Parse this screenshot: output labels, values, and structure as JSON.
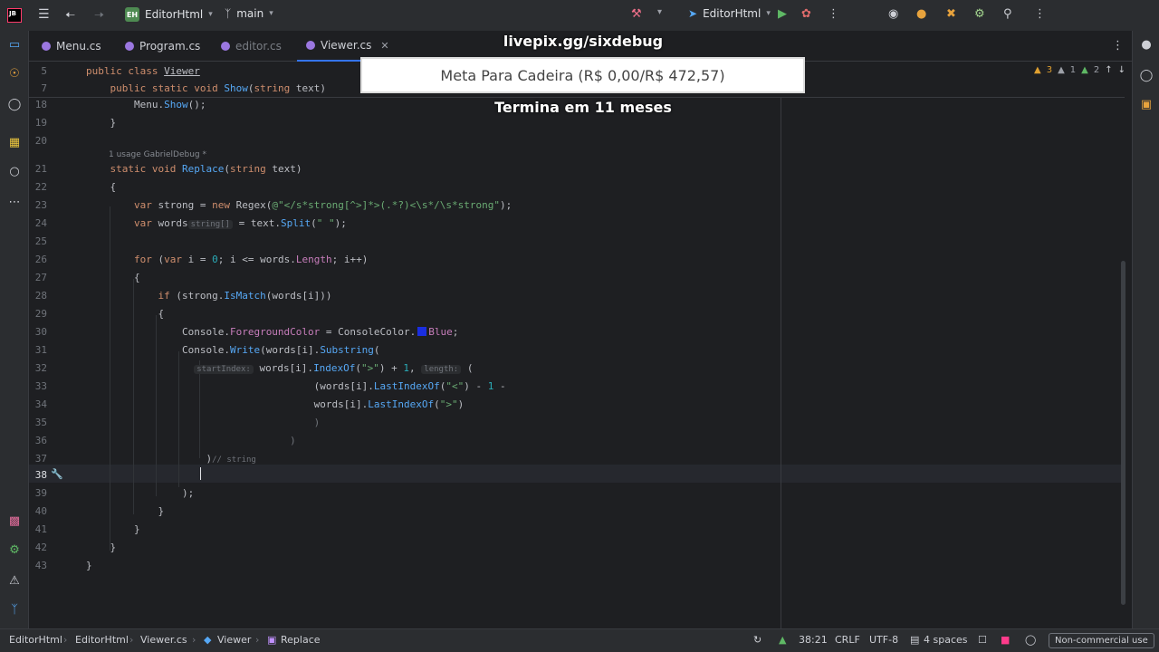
{
  "titlebar": {
    "logo_text": "JB",
    "project_badge": "EH",
    "project_name": "EditorHtml",
    "branch": "main",
    "run_config": "EditorHtml"
  },
  "tabs": [
    {
      "label": "Menu.cs",
      "active": false
    },
    {
      "label": "Program.cs",
      "active": false
    },
    {
      "label": "editor.cs",
      "active": false
    },
    {
      "label": "Viewer.cs",
      "active": true
    }
  ],
  "overlay": {
    "host": "livepix.gg/sixdebug",
    "goal": "Meta Para Cadeira (R$ 0,00/R$ 472,57)",
    "ends": "Termina em 11 meses"
  },
  "problems": {
    "warnings": "3",
    "weak": "1",
    "typos": "2"
  },
  "code": {
    "sticky": [
      {
        "num": "5",
        "text": "public class Viewer"
      },
      {
        "num": "7",
        "text": "    public static void Show(string text)"
      }
    ],
    "usage_hint": "1 usage   GabrielDebug *",
    "lines": [
      {
        "num": "18",
        "text": "        Menu.Show();"
      },
      {
        "num": "19",
        "text": "    }"
      },
      {
        "num": "20",
        "text": ""
      },
      {
        "num": "21",
        "text": "    static void Replace(string text)"
      },
      {
        "num": "22",
        "text": "    {"
      },
      {
        "num": "23",
        "text": "        var strong = new Regex(@\"</s*strong[^>]*>(.*?)<\\s*/\\s*strong\");"
      },
      {
        "num": "24",
        "text": "        var words = text.Split(\" \");"
      },
      {
        "num": "25",
        "text": ""
      },
      {
        "num": "26",
        "text": "        for (var i = 0; i <= words.Length; i++)"
      },
      {
        "num": "27",
        "text": "        {"
      },
      {
        "num": "28",
        "text": "            if (strong.IsMatch(words[i]))"
      },
      {
        "num": "29",
        "text": "            {"
      },
      {
        "num": "30",
        "text": "                Console.ForegroundColor = ConsoleColor.  Blue;"
      },
      {
        "num": "31",
        "text": "                Console.Write(words[i].Substring("
      },
      {
        "num": "32",
        "text": "                              words[i].IndexOf(\">\") + 1,"
      },
      {
        "num": "33",
        "text": "                                      (words[i].LastIndexOf(\"<\") - 1 -"
      },
      {
        "num": "34",
        "text": "                                      words[i].LastIndexOf(\">\")"
      },
      {
        "num": "35",
        "text": "                                      )"
      },
      {
        "num": "36",
        "text": "                                  )"
      },
      {
        "num": "37",
        "text": "                    )"
      },
      {
        "num": "38",
        "text": ""
      },
      {
        "num": "39",
        "text": "                );"
      },
      {
        "num": "40",
        "text": "            }"
      },
      {
        "num": "41",
        "text": "        }"
      },
      {
        "num": "42",
        "text": "    }"
      },
      {
        "num": "43",
        "text": "}"
      }
    ],
    "inlay": {
      "words_type": "string[]",
      "start_index": "startIndex:",
      "length": "length:",
      "comment": "// string"
    }
  },
  "statusbar": {
    "crumbs": [
      "EditorHtml",
      "EditorHtml",
      "Viewer.cs",
      "Viewer",
      "Replace"
    ],
    "position": "38:21",
    "line_sep": "CRLF",
    "encoding": "UTF-8",
    "indent": "4 spaces",
    "license": "Non-commercial use"
  },
  "colors": {
    "accent": "#3574f0",
    "keyword": "#cf8e6d",
    "string": "#6aab73",
    "method": "#56a8f5"
  }
}
